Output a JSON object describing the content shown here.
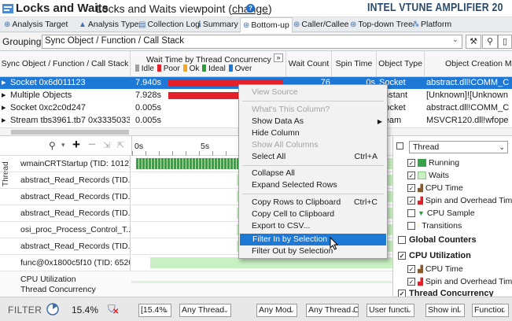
{
  "window": {
    "title": "Locks and Waits",
    "subtitle": "Locks and Waits viewpoint",
    "change_link": "change",
    "help": "?",
    "brand": "INTEL VTUNE AMPLIFIER 20"
  },
  "tabs": [
    {
      "label": "Analysis Target"
    },
    {
      "label": "Analysis Type"
    },
    {
      "label": "Collection Log"
    },
    {
      "label": "Summary"
    },
    {
      "label": "Bottom-up"
    },
    {
      "label": "Caller/Callee"
    },
    {
      "label": "Top-down Tree"
    },
    {
      "label": "Platform"
    }
  ],
  "grouping": {
    "label": "Grouping:",
    "value": "Sync Object / Function / Call Stack"
  },
  "grid": {
    "headers": {
      "sync_object": "Sync Object / Function / Call Stack",
      "wait_time": "Wait Time by Thread Concurrency",
      "wait_count": "Wait Count",
      "spin_time": "Spin Time",
      "object_type": "Object Type",
      "creation_module": "Object Creation Mo"
    },
    "concurrency_legend": [
      "Idle",
      "Poor",
      "Ok",
      "Ideal",
      "Over"
    ],
    "concurrency_colors": {
      "Idle": "#9e9e9e",
      "Poor": "#e4212a",
      "Ok": "#f5a623",
      "Ideal": "#2e9e3a",
      "Over": "#1e78d6"
    },
    "expand_button": "»",
    "rows": [
      {
        "name": "Socket 0x6d011123",
        "wait_time": "7.940s",
        "bar_fraction": 1.0,
        "wait_count": "76",
        "spin_time": "0s",
        "object_type": "Socket",
        "module": "abstract.dll!COMM_C"
      },
      {
        "name": "Multiple Objects",
        "wait_time": "7.928s",
        "bar_fraction": 0.985,
        "wait_count": "",
        "spin_time": "",
        "object_type": "onstant",
        "module": "[Unknown]![Unknown"
      },
      {
        "name": "Socket 0xc2c0d247",
        "wait_time": "0.005s",
        "bar_fraction": 0,
        "wait_count": "",
        "spin_time": "",
        "object_type": "Socket",
        "module": "abstract.dll!COMM_C"
      },
      {
        "name": "Stream tbs3961.tb7 0x3335033c",
        "wait_time": "0.005s",
        "bar_fraction": 0,
        "wait_count": "",
        "spin_time": "",
        "object_type": "tream",
        "module": "MSVCR120.dll!wfope"
      }
    ]
  },
  "timeline": {
    "vertical_label": "Thread",
    "axis_ticks": [
      "0s",
      "5s"
    ],
    "threads": [
      {
        "label": "wmainCRTStartup (TID: 1012)"
      },
      {
        "label": "abstract_Read_Records (TID..."
      },
      {
        "label": "abstract_Read_Records (TID..."
      },
      {
        "label": "abstract_Read_Records (TID..."
      },
      {
        "label": "osi_proc_Process_Control_T..."
      },
      {
        "label": "abstract_Read_Records (TID..."
      },
      {
        "label": "func@0x1800c5f10 (TID: 6520)"
      }
    ],
    "summary_rows": [
      {
        "label": "CPU Utilization"
      },
      {
        "label": "Thread Concurrency"
      }
    ]
  },
  "legend": {
    "thread_dropdown": "Thread",
    "thread_items": [
      {
        "label": "Running",
        "checked": true,
        "color": "#3aa14b"
      },
      {
        "label": "Waits",
        "checked": true,
        "color": "#c9f0c2"
      },
      {
        "label": "CPU Time",
        "checked": true,
        "color": "#8b5a2b"
      },
      {
        "label": "Spin and Overhead Time",
        "checked": true,
        "color": "#e4212a"
      },
      {
        "label": "CPU Sample",
        "checked": false,
        "color": "#2e9e3a"
      },
      {
        "label": "Transitions",
        "checked": false,
        "color": "#f5a623"
      }
    ],
    "global_counters": "Global Counters",
    "cpu_utilization": "CPU Utilization",
    "cpu_items": [
      {
        "label": "CPU Time",
        "checked": true
      },
      {
        "label": "Spin and Overhead Time",
        "checked": true
      }
    ],
    "thread_concurrency": "Thread Concurrency"
  },
  "filter": {
    "label": "FILTER",
    "percent": "15.4%",
    "selects": [
      "[15.4%",
      "Any Thread",
      "Any Mod",
      "Any Thread C",
      "User functi",
      "Show inl",
      "Functior"
    ]
  },
  "context_menu": {
    "items": [
      {
        "label": "View Source",
        "disabled": true
      },
      {
        "sep": true
      },
      {
        "label": "What's This Column?",
        "disabled": true
      },
      {
        "label": "Show Data As",
        "submenu": true
      },
      {
        "label": "Hide Column"
      },
      {
        "label": "Show All Columns",
        "disabled": true
      },
      {
        "label": "Select All",
        "shortcut": "Ctrl+A"
      },
      {
        "sep": true
      },
      {
        "label": "Collapse All"
      },
      {
        "label": "Expand Selected Rows"
      },
      {
        "sep": true
      },
      {
        "label": "Copy Rows to Clipboard",
        "shortcut": "Ctrl+C"
      },
      {
        "label": "Copy Cell to Clipboard"
      },
      {
        "label": "Export to CSV..."
      },
      {
        "sep": true
      },
      {
        "label": "Filter In by Selection",
        "highlighted": true
      },
      {
        "label": "Filter Out by Selection"
      }
    ]
  }
}
